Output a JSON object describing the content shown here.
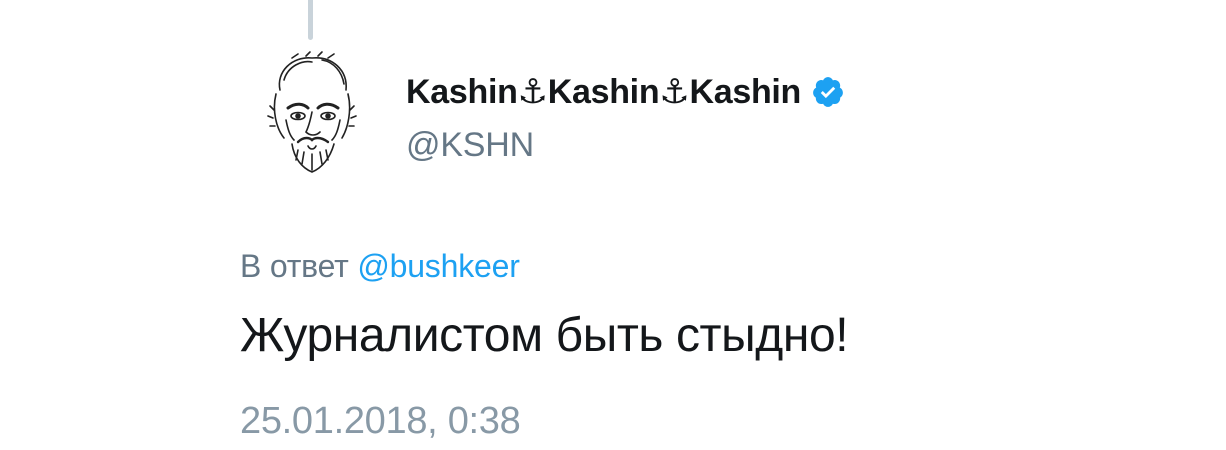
{
  "tweet": {
    "author": {
      "display_name": "Kashin⚓Kashin⚓Kashin",
      "handle": "@KSHN",
      "verified": true,
      "avatar_icon": "sketch-portrait-avatar"
    },
    "reply": {
      "prefix": "В ответ",
      "mention": "@bushkeer"
    },
    "text": "Журналистом быть стыдно!",
    "timestamp": "25.01.2018, 0:38"
  },
  "colors": {
    "text_primary": "#14171a",
    "text_secondary": "#657786",
    "accent": "#1da1f2",
    "thread_line": "#c9d3da"
  }
}
